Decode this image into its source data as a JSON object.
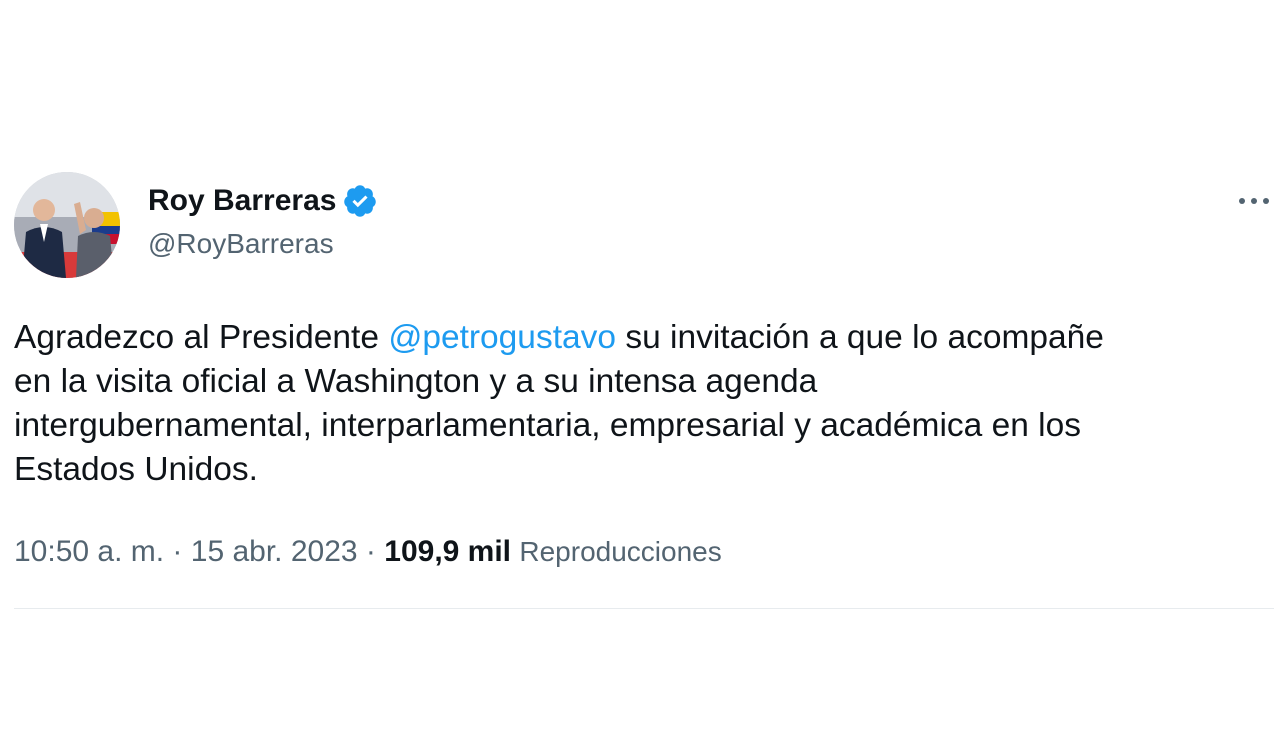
{
  "author": {
    "display_name": "Roy Barreras",
    "handle": "@RoyBarreras",
    "verified": true,
    "avatar_icon": "profile-photo",
    "verified_icon": "verified-badge-icon",
    "verified_color": "#1d9bf0"
  },
  "menu": {
    "icon": "more-options-icon",
    "label": "•••"
  },
  "tweet": {
    "lines": [
      {
        "before": "Agradezco al Presidente ",
        "mention": "@petrogustavo",
        "after": " su invitación a que lo acompañe"
      },
      {
        "text": "en la visita oficial a Washington y a su intensa agenda"
      },
      {
        "text": "intergubernamental, interparlamentaria, empresarial y académica en los"
      },
      {
        "text": "Estados Unidos."
      }
    ],
    "mention_color": "#1d9bf0"
  },
  "meta": {
    "time": "10:50 a. m.",
    "separator": " · ",
    "date": "15 abr. 2023",
    "views_count": "109,9 mil",
    "views_label": "Reproducciones"
  }
}
